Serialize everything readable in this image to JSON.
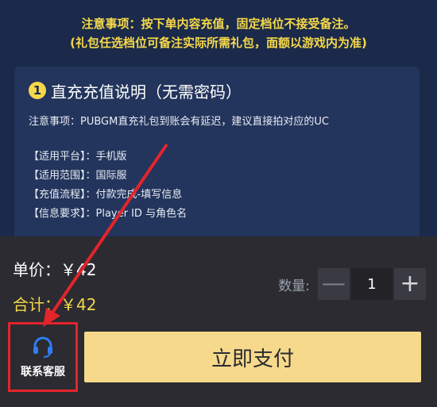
{
  "notice": {
    "line1": "注意事项：按下单内容充值，固定档位不接受备注。",
    "line2": "(礼包任选档位可备注实际所需礼包，面额以游戏内为准)"
  },
  "card": {
    "badge": "1",
    "title": "直充充值说明（无需密码）",
    "note": "注意事项：PUBGM直充礼包到账会有延迟，建议直接拍对应的UC",
    "specs": [
      "【适用平台】：手机版",
      "【适用范围】：国际服",
      "【充值流程】：付款完成-填写信息",
      "【信息要求】：Player ID 与角色名"
    ]
  },
  "order": {
    "unit_price": "单价：￥42",
    "total_price": "合计：￥42",
    "qty_label": "数量:",
    "qty_value": "1",
    "minus": "—",
    "plus": "+"
  },
  "service": {
    "label": "联系客服",
    "icon": "headset-icon"
  },
  "pay": {
    "label": "立即支付"
  },
  "colors": {
    "accent": "#f5d84a",
    "highlight": "#e3242b",
    "pay_bg": "#f6d98a"
  }
}
